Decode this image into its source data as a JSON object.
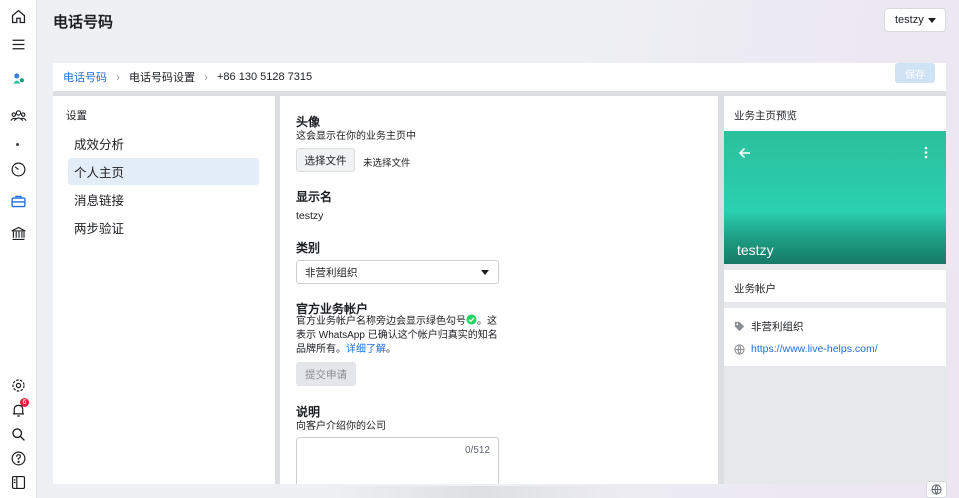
{
  "header": {
    "title": "电话号码",
    "account_name": "testzy"
  },
  "breadcrumb": {
    "items": [
      "电话号码",
      "电话号码设置",
      "+86 130 5128 7315"
    ],
    "save_label": "保存"
  },
  "settings_nav": {
    "heading": "设置",
    "items": [
      {
        "label": "成效分析"
      },
      {
        "label": "个人主页"
      },
      {
        "label": "消息链接"
      },
      {
        "label": "两步验证"
      }
    ],
    "active": "个人主页"
  },
  "form": {
    "avatar": {
      "title": "头像",
      "subtitle": "这会显示在你的业务主页中",
      "choose_file_label": "选择文件",
      "no_file_label": "未选择文件"
    },
    "display_name": {
      "title": "显示名",
      "value": "testzy"
    },
    "category": {
      "title": "类别",
      "selected": "非营利组织"
    },
    "official_account": {
      "title": "官方业务帐户",
      "text_1": "官方业务帐户名称旁边会显示绿色勾号",
      "text_2": "。这表示 WhatsApp 已确认这个帐户归真实的知名品牌所有。",
      "learn_more": "详细了解",
      "text_3": "。",
      "submit_label": "提交申请"
    },
    "description": {
      "title": "说明",
      "subtitle": "向客户介绍你的公司",
      "counter": "0/512"
    }
  },
  "preview": {
    "heading": "业务主页预览",
    "name": "testzy",
    "section_title": "业务帐户",
    "category": "非营利组织",
    "website": "https://www.live-helps.com/"
  },
  "rail": {
    "notification_count": "6"
  },
  "colors": {
    "accent": "#216fdb",
    "hero_green": "#2ad0b0",
    "check_green": "#25d366"
  }
}
